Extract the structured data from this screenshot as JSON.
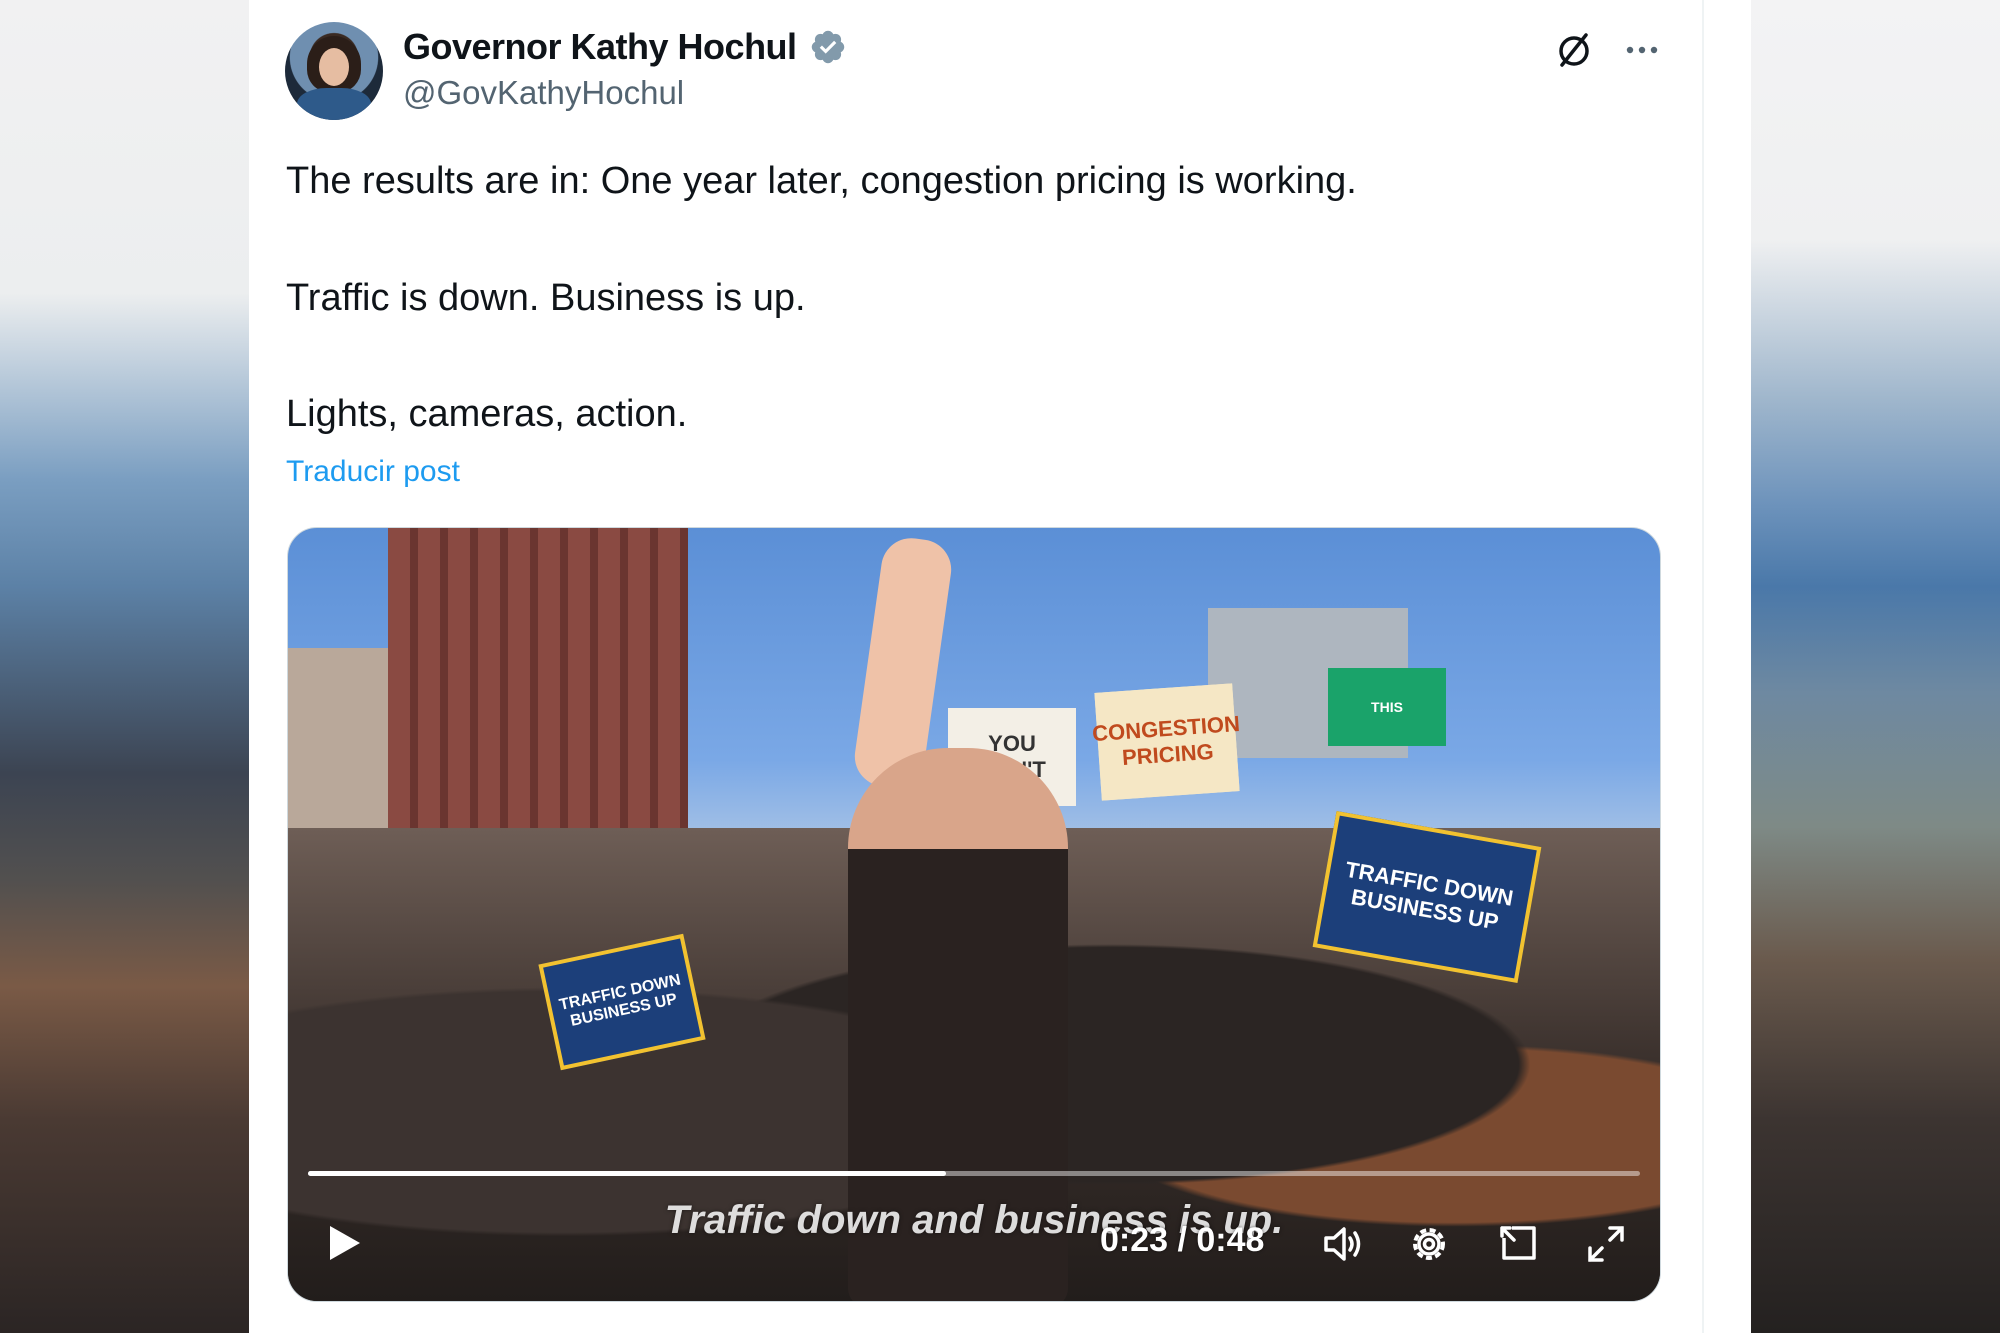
{
  "author": {
    "display_name": "Governor Kathy Hochul",
    "handle": "@GovKathyHochul",
    "verified": true
  },
  "post": {
    "lines": [
      "The results are in: One year later, congestion pricing is working.",
      "Traffic is down. Business is up.",
      "Lights, cameras, action."
    ],
    "translate_label": "Traducir post"
  },
  "video": {
    "caption": "Traffic down and business is up.",
    "time_display": "0:23 / 0:48",
    "progress": 0.479,
    "signs": [
      "TRAFFIC DOWN BUSINESS UP",
      "TRAFFIC DOWN BUSINESS UP",
      "YOU DON'T",
      "CONGESTION PRICING",
      "THIS"
    ]
  },
  "icons": {
    "verified": "verified-badge-icon",
    "grok": "grok-icon",
    "more": "more-options-icon",
    "play": "play-icon",
    "volume": "volume-icon",
    "settings": "settings-gear-icon",
    "pip": "picture-in-picture-icon",
    "fullscreen": "fullscreen-icon"
  },
  "colors": {
    "link": "#1d9bf0",
    "text": "#0f1419",
    "secondary": "#536471",
    "verified": "#829aab"
  }
}
